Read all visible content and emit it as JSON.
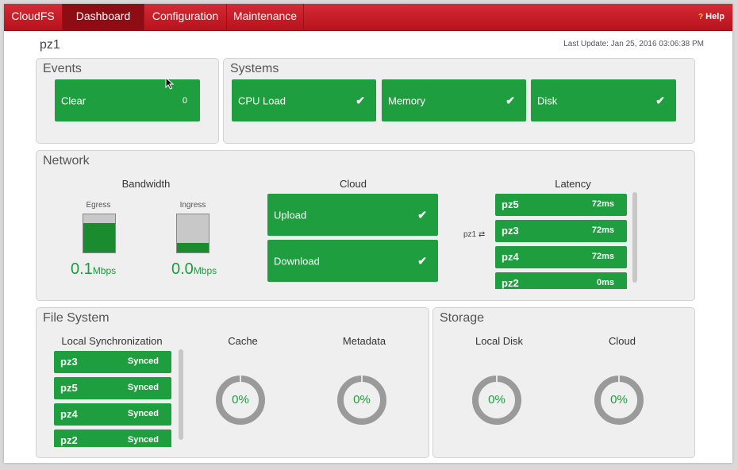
{
  "nav": {
    "brand": "CloudFS",
    "tabs": [
      "Dashboard",
      "Configuration",
      "Maintenance"
    ],
    "help_icon": "?",
    "help": "Help"
  },
  "header": {
    "host": "pz1",
    "last_update": "Last Update: Jan 25, 2016 03:06:38 PM"
  },
  "events": {
    "title": "Events",
    "tile_label": "Clear",
    "tile_value": "0"
  },
  "systems": {
    "title": "Systems",
    "tiles": [
      "CPU Load",
      "Memory",
      "Disk"
    ],
    "check": "✔"
  },
  "network": {
    "title": "Network",
    "bandwidth": {
      "title": "Bandwidth",
      "egress_label": "Egress",
      "ingress_label": "Ingress",
      "egress_level": 0.78,
      "ingress_level": 0.24,
      "egress_value": "0.1",
      "ingress_value": "0.0",
      "unit": "Mbps"
    },
    "cloud": {
      "title": "Cloud",
      "upload": "Upload",
      "download": "Download"
    },
    "latency": {
      "title": "Latency",
      "source": "pz1",
      "swap_icon": "⇄",
      "rows": [
        {
          "name": "pz5",
          "value": "72ms"
        },
        {
          "name": "pz3",
          "value": "72ms"
        },
        {
          "name": "pz4",
          "value": "72ms"
        },
        {
          "name": "pz2",
          "value": "0ms"
        }
      ]
    }
  },
  "filesystem": {
    "title": "File System",
    "local_sync_title": "Local Synchronization",
    "sync_rows": [
      {
        "name": "pz3",
        "status": "Synced"
      },
      {
        "name": "pz5",
        "status": "Synced"
      },
      {
        "name": "pz4",
        "status": "Synced"
      },
      {
        "name": "pz2",
        "status": "Synced"
      }
    ],
    "cache_title": "Cache",
    "cache_value": "0%",
    "metadata_title": "Metadata",
    "metadata_value": "0%"
  },
  "storage": {
    "title": "Storage",
    "local_disk_title": "Local Disk",
    "local_disk_value": "0%",
    "cloud_title": "Cloud",
    "cloud_value": "0%"
  },
  "colors": {
    "brand_red": "#c41a24",
    "ok_green": "#1e9e3e",
    "donut_gray": "#9a9a9a"
  }
}
